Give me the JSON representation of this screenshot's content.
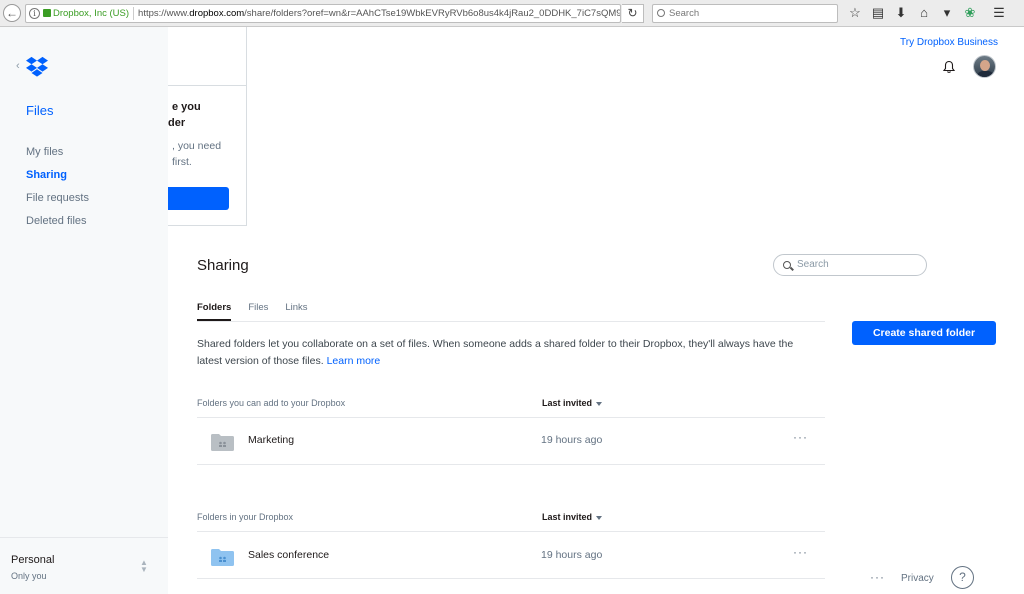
{
  "browser": {
    "site_identity": "Dropbox, Inc (US)",
    "url_prefix": "https://www.",
    "url_domain": "dropbox.com",
    "url_path": "/share/folders?oref=wn&r=AAhCTse19WbkEVRyRVb6o8us4k4jRau2_0DDHK_7iC7sQM9mfo",
    "search_placeholder": "Search",
    "icons": [
      "star-icon",
      "reading-list-icon",
      "download-icon",
      "home-icon",
      "pocket-icon",
      "extension-icon",
      "menu-icon"
    ]
  },
  "sidebar": {
    "section_title": "Files",
    "items": [
      {
        "label": "My files",
        "active": false
      },
      {
        "label": "Sharing",
        "active": true
      },
      {
        "label": "File requests",
        "active": false
      },
      {
        "label": "Deleted files",
        "active": false
      }
    ],
    "account_name": "Personal",
    "account_sub": "Only you"
  },
  "popover": {
    "title_line1": "e you",
    "title_line2": "der",
    "body_line1": ", you need",
    "body_line2": "first."
  },
  "header": {
    "try_business": "Try Dropbox Business"
  },
  "main": {
    "title": "Sharing",
    "search_placeholder": "Search",
    "tabs": [
      {
        "label": "Folders",
        "active": true
      },
      {
        "label": "Files",
        "active": false
      },
      {
        "label": "Links",
        "active": false
      }
    ],
    "intro_text": "Shared folders let you collaborate on a set of files. When someone adds a shared folder to their Dropbox, they'll always have the latest version of those files.",
    "learn_more": "Learn more",
    "create_button": "Create shared folder",
    "sections": [
      {
        "heading": "Folders you can add to your Dropbox",
        "sort_label": "Last invited",
        "rows": [
          {
            "name": "Marketing",
            "when": "19 hours ago",
            "more": "···",
            "folder_color": "#b9bfc4"
          }
        ]
      },
      {
        "heading": "Folders in your Dropbox",
        "sort_label": "Last invited",
        "rows": [
          {
            "name": "Sales conference",
            "when": "19 hours ago",
            "more": "···",
            "folder_color": "#8fc3f0"
          }
        ]
      }
    ]
  },
  "footer": {
    "more": "···",
    "privacy": "Privacy",
    "help": "?"
  },
  "colors": {
    "accent": "#0061fe",
    "sidebar_bg": "#f7f9fa",
    "muted_text": "#637282"
  }
}
